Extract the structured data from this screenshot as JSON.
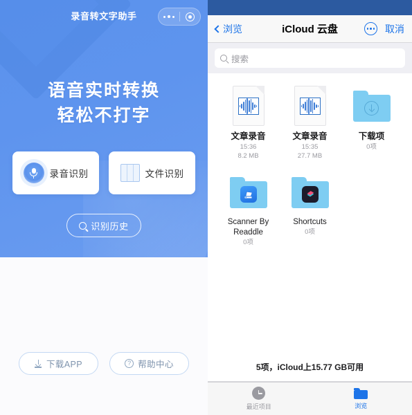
{
  "left_app": {
    "nav": {
      "title": "录音转文字助手",
      "capsule": {
        "menu_icon": "ellipsis-icon",
        "close_icon": "target-circle-icon"
      }
    },
    "hero": {
      "line1": "语音实时转换",
      "line2": "轻松不打字"
    },
    "actions": [
      {
        "label": "录音识别",
        "icon": "microphone-icon"
      },
      {
        "label": "文件识别",
        "icon": "document-file-icon"
      }
    ],
    "history_button": {
      "label": "识别历史",
      "icon": "search-icon"
    },
    "footer_buttons": [
      {
        "label": "下载APP",
        "icon": "download-icon"
      },
      {
        "label": "帮助中心",
        "icon": "question-mark-icon"
      }
    ],
    "colors": {
      "brand": "#5b92ec",
      "card": "#ffffff",
      "footer_text": "#7e93ad"
    }
  },
  "right_app": {
    "nav": {
      "back_label": "浏览",
      "title": "iCloud 云盘",
      "more_icon": "ellipsis-circle-icon",
      "cancel_label": "取消"
    },
    "search": {
      "placeholder": "搜索",
      "icon": "search-icon"
    },
    "files": [
      {
        "name": "文章录音",
        "time": "15:36",
        "size": "8.2 MB",
        "kind": "audio-document",
        "cjk": true
      },
      {
        "name": "文章录音",
        "time": "15:35",
        "size": "27.7 MB",
        "kind": "audio-document",
        "cjk": true
      },
      {
        "name": "下载项",
        "time": "0项",
        "size": "",
        "kind": "folder-download",
        "cjk": true
      },
      {
        "name": "Scanner By Readdle",
        "time": "0项",
        "size": "",
        "kind": "folder-scanner",
        "cjk": false
      },
      {
        "name": "Shortcuts",
        "time": "0项",
        "size": "",
        "kind": "folder-shortcuts",
        "cjk": false
      }
    ],
    "status": "5项，iCloud上15.77 GB可用",
    "tabs": [
      {
        "label": "最近项目",
        "icon": "clock-icon",
        "active": false
      },
      {
        "label": "浏览",
        "icon": "folder-icon",
        "active": true
      }
    ],
    "colors": {
      "accent": "#1d74e8",
      "folder": "#7ecdf2",
      "chrome": "#f8f8f8"
    }
  }
}
